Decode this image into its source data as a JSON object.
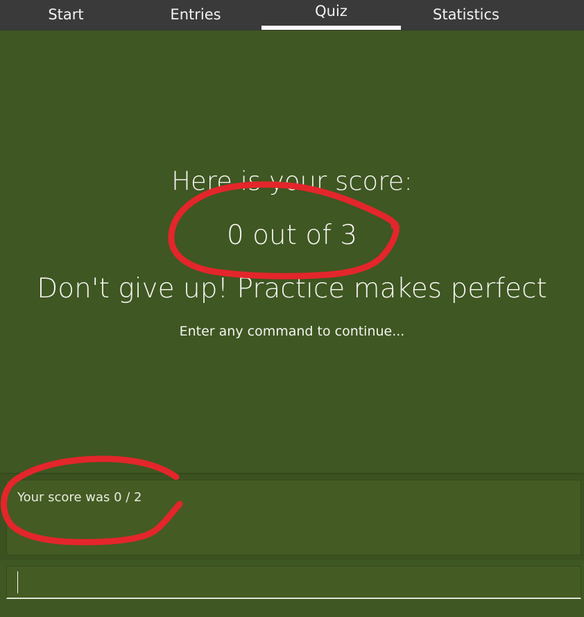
{
  "tabs": [
    {
      "label": "Start",
      "active": false
    },
    {
      "label": "Entries",
      "active": false
    },
    {
      "label": "Quiz",
      "active": true
    },
    {
      "label": "Statistics",
      "active": false
    }
  ],
  "main": {
    "score_heading": "Here is your score:",
    "score_value": "0 out of 3",
    "encouragement": "Don't give up! Practice makes perfect",
    "continue_hint": "Enter any command to continue..."
  },
  "result": {
    "text": "Your score was 0 / 2"
  },
  "command": {
    "value": ""
  },
  "colors": {
    "background": "#3f5722",
    "tabbar": "#3a3a3a",
    "annotation": "#e3262b"
  }
}
